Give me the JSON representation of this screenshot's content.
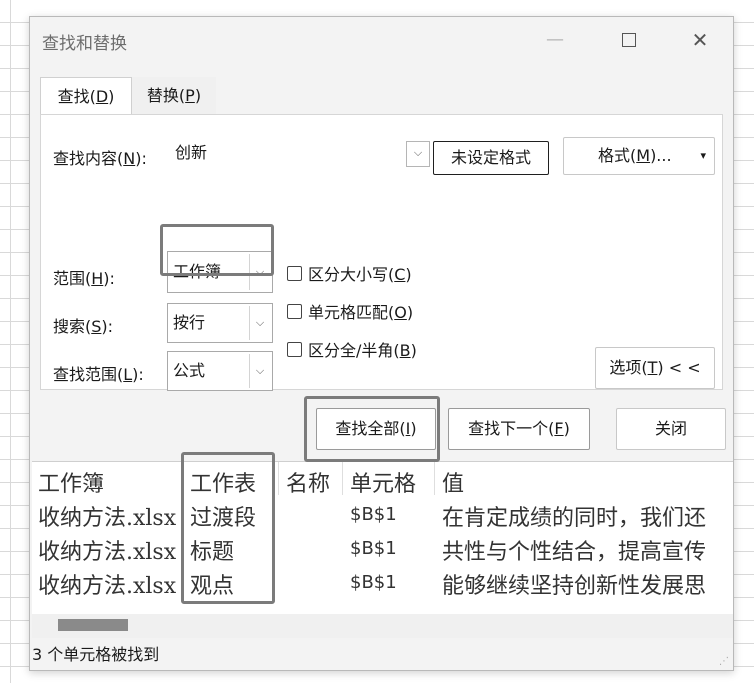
{
  "dialog": {
    "title": "查找和替换",
    "window_controls": [
      "—",
      "☐",
      "✕"
    ]
  },
  "tabs": [
    {
      "label_prefix": "查找(",
      "key": "D",
      "label_suffix": ")",
      "active": true
    },
    {
      "label_prefix": "替换(",
      "key": "P",
      "label_suffix": ")",
      "active": false
    }
  ],
  "find": {
    "label_prefix": "查找内容(",
    "key": "N",
    "label_suffix": "):",
    "value": "创新",
    "no_format_button": "未设定格式",
    "format_button_prefix": "格式(",
    "format_key": "M",
    "format_button_suffix": ")...",
    "format_arrow": "▾"
  },
  "options": {
    "within": {
      "label_prefix": "范围(",
      "key": "H",
      "label_suffix": "):",
      "value": "工作簿"
    },
    "search": {
      "label_prefix": "搜索(",
      "key": "S",
      "label_suffix": "):",
      "value": "按行"
    },
    "look_in": {
      "label_prefix": "查找范围(",
      "key": "L",
      "label_suffix": "):",
      "value": "公式"
    },
    "match_case": {
      "label_prefix": "区分大小写(",
      "key": "C",
      "label_suffix": ")",
      "checked": false
    },
    "match_cell": {
      "label_prefix": "单元格匹配(",
      "key": "O",
      "label_suffix": ")",
      "checked": false
    },
    "match_width": {
      "label_prefix": "区分全/半角(",
      "key": "B",
      "label_suffix": ")",
      "checked": false
    },
    "options_button_prefix": "选项(",
    "options_key": "T",
    "options_button_suffix": ") < <"
  },
  "actions": {
    "find_all_prefix": "查找全部(",
    "find_all_key": "I",
    "find_all_suffix": ")",
    "find_next_prefix": "查找下一个(",
    "find_next_key": "F",
    "find_next_suffix": ")",
    "close": "关闭"
  },
  "results": {
    "headers": [
      "工作簿",
      "工作表",
      "名称",
      "单元格",
      "值"
    ],
    "rows": [
      [
        "收纳方法.xlsx",
        "过渡段",
        "",
        "$B$1",
        "在肯定成绩的同时，我们还"
      ],
      [
        "收纳方法.xlsx",
        "标题",
        "",
        "$B$1",
        "共性与个性结合，提高宣传"
      ],
      [
        "收纳方法.xlsx",
        "观点",
        "",
        "$B$1",
        "能够继续坚持创新性发展思"
      ]
    ]
  },
  "status": "3 个单元格被找到",
  "colors": {
    "highlight_border": "#7b7b7b",
    "dialog_bg": "#f3f3f3"
  }
}
